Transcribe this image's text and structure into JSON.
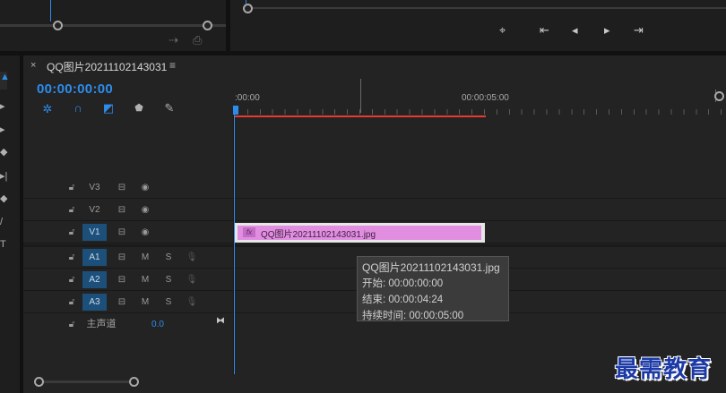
{
  "sequence": {
    "title": "QQ图片20211102143031",
    "timecode": "00:00:00:00",
    "close_glyph": "×",
    "menu_glyph": "≡"
  },
  "ruler": {
    "start_label": ":00:00",
    "mid_label": "00:00:05:00"
  },
  "video_tracks": [
    {
      "label": "V3",
      "target": false
    },
    {
      "label": "V2",
      "target": false
    },
    {
      "label": "V1",
      "target": true
    }
  ],
  "audio_tracks": [
    {
      "label": "A1",
      "mute": "M",
      "solo": "S"
    },
    {
      "label": "A2",
      "mute": "M",
      "solo": "S"
    },
    {
      "label": "A3",
      "mute": "M",
      "solo": "S"
    }
  ],
  "master": {
    "label": "主声道",
    "value": "0.0"
  },
  "clip": {
    "name": "QQ图片20211102143031.jpg",
    "fx": "fx"
  },
  "tooltip": {
    "name": "QQ图片20211102143031.jpg",
    "start": "开始: 00:00:00:00",
    "end": "结束: 00:00:04:24",
    "duration": "持续时间: 00:00:05:00"
  },
  "watermark": "最需教育",
  "colors": {
    "accent": "#2d8ceb",
    "clip": "#e18ee1",
    "work_area": "#e83a2e",
    "target": "#1c4f79"
  }
}
